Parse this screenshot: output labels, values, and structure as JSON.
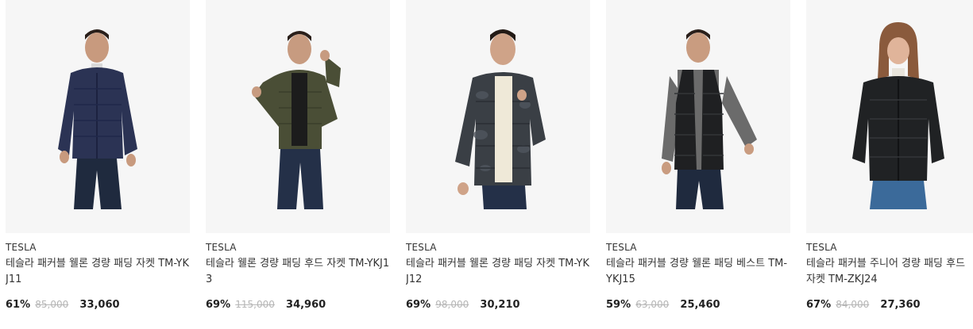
{
  "products": [
    {
      "brand": "TESLA",
      "name": "테슬라 패커블 웰론 경량 패딩 자켓 TM-YKJ11",
      "discount": "61%",
      "original_price": "85,000",
      "sale_price": "33,060",
      "jacket_color": "#2b3354",
      "inner_color": "#d9d9d9",
      "image_icon": "product-photo-navy-puffer-jacket"
    },
    {
      "brand": "TESLA",
      "name": "테슬라 웰론 경량 패딩 후드 자켓 TM-YKJ13",
      "discount": "69%",
      "original_price": "115,000",
      "sale_price": "34,960",
      "jacket_color": "#4a4e36",
      "inner_color": "#1c1c1c",
      "image_icon": "product-photo-olive-hooded-puffer-jacket"
    },
    {
      "brand": "TESLA",
      "name": "테슬라 패커블 웰론 경량 패딩 자켓 TM-YKJ12",
      "discount": "69%",
      "original_price": "98,000",
      "sale_price": "30,210",
      "jacket_color": "#3a3f45",
      "inner_color": "#efe9d8",
      "image_icon": "product-photo-camo-puffer-jacket"
    },
    {
      "brand": "TESLA",
      "name": "테슬라 패커블 경량 웰론 패딩 베스트 TM-YKJ15",
      "discount": "59%",
      "original_price": "63,000",
      "sale_price": "25,460",
      "jacket_color": "#1f2022",
      "inner_color": "#6b6b6b",
      "image_icon": "product-photo-black-puffer-vest"
    },
    {
      "brand": "TESLA",
      "name": "테슬라 패커블 주니어 경량 패딩 후드 자켓 TM-ZKJ24",
      "discount": "67%",
      "original_price": "84,000",
      "sale_price": "27,360",
      "jacket_color": "#202224",
      "inner_color": "#e8e4dc",
      "image_icon": "product-photo-junior-black-puffer-jacket"
    }
  ]
}
